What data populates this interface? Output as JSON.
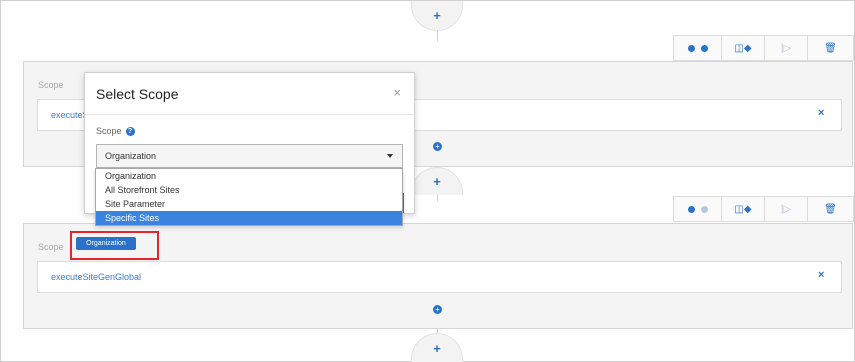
{
  "flow": {
    "add_symbol": "+"
  },
  "toolbar": {
    "icons": [
      "play-icon",
      "play-icon",
      "split-icon",
      "step-icon",
      "trash-icon"
    ],
    "split_label": "◫◆",
    "step_label": "|▷",
    "trash_label": "🗑"
  },
  "step1": {
    "scope_label": "Scope",
    "job_name": "executeSiteGenSomething",
    "close": "×",
    "add": "+"
  },
  "step2": {
    "scope_label": "Scope",
    "scope_badge": "Organization",
    "job_name": "executeSiteGenGlobal",
    "close": "×",
    "add": "+"
  },
  "modal": {
    "title": "Select Scope",
    "close": "×",
    "field_label": "Scope",
    "help": "?",
    "selected_value": "Organization",
    "options": [
      "Organization",
      "All Storefront Sites",
      "Site Parameter",
      "Specific Sites"
    ],
    "highlighted_option": "Specific Sites"
  },
  "colors": {
    "accent": "#2a72c9",
    "highlight": "#e3262c",
    "option_selected": "#3a84e0"
  }
}
